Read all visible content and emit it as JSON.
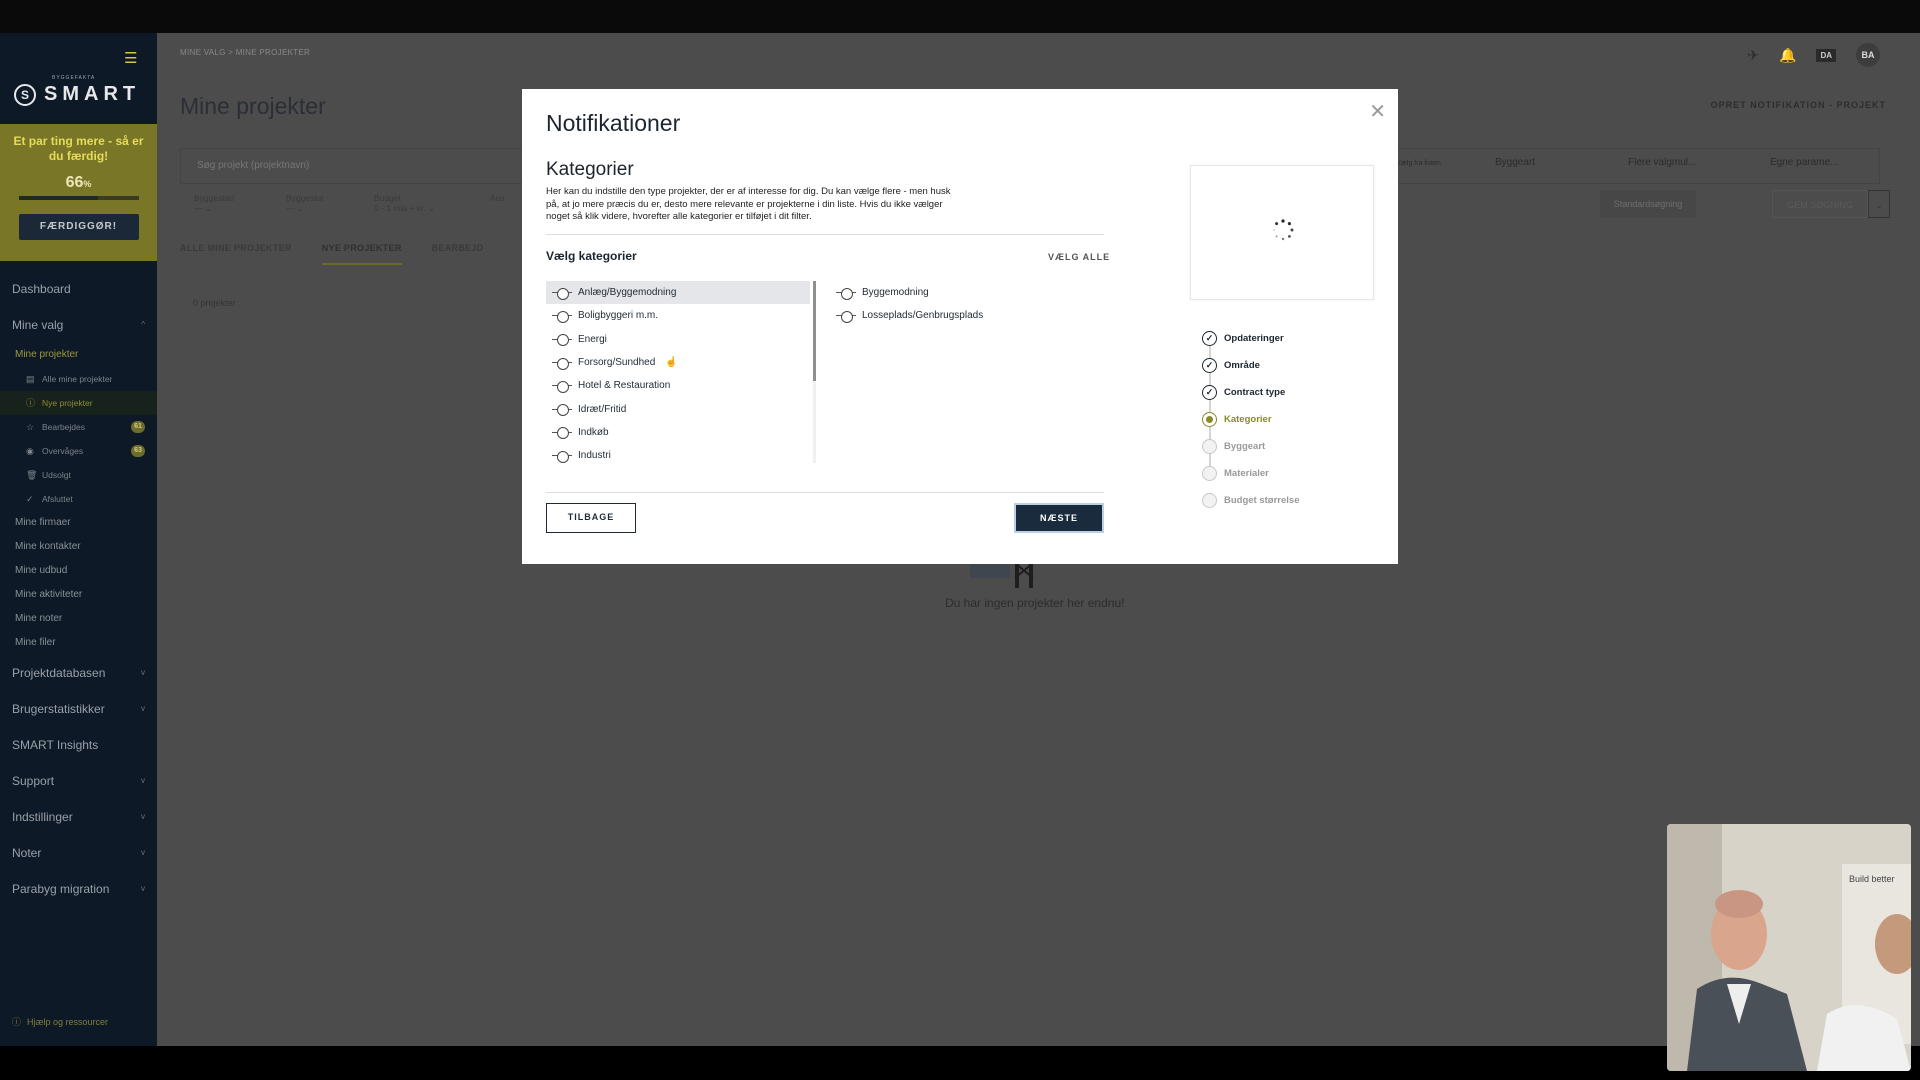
{
  "sidebar": {
    "logo_text": "SMART",
    "logo_sub": "BYGGEFAKTA",
    "promo": {
      "title": "Et par ting mere - så er du færdig!",
      "percent": "66",
      "percent_unit": "%",
      "progress": 0.66,
      "button": "FÆRDIGGØR!"
    },
    "nav": [
      "Dashboard",
      "Mine valg",
      "Projektdatabasen",
      "Brugerstatistikker",
      "SMART Insights",
      "Support",
      "Indstillinger",
      "Noter",
      "Parabyg migration"
    ],
    "mine_valg_sub": {
      "projects": "Mine projekter",
      "project_items": [
        {
          "label": "Alle mine projekter"
        },
        {
          "label": "Nye projekter"
        },
        {
          "label": "Bearbejdes",
          "badge": "61"
        },
        {
          "label": "Overvåges",
          "badge": "63"
        },
        {
          "label": "Udsolgt"
        },
        {
          "label": "Afsluttet"
        }
      ],
      "others": [
        "Mine firmaer",
        "Mine kontakter",
        "Mine udbud",
        "Mine aktiviteter",
        "Mine noter",
        "Mine filer"
      ]
    },
    "help": "Hjælp og ressourcer"
  },
  "header": {
    "breadcrumb": "MINE VALG  >  MINE PROJEKTER",
    "title": "Mine projekter",
    "lang": "DA",
    "avatar": "BA",
    "create_notification": "OPRET NOTIFIKATION - PROJEKT"
  },
  "filters": {
    "search_placeholder": "Søg projekt (projektnavn)",
    "groups": [
      {
        "label": "Byggestart",
        "value": "— ⌄"
      },
      {
        "label": "Byggeslut",
        "value": "— ⌄"
      },
      {
        "label": "Budget",
        "value": "0 - 1 mia + kr. ⌄"
      },
      {
        "label": "Ans",
        "value": ""
      }
    ],
    "chips": [
      "Vælg fra listen",
      "Byggeart",
      "Flere valgmul...",
      "Egne parame..."
    ],
    "standard_button": "Standardsøgning",
    "save_button": "GEM SØGNING"
  },
  "tabs": [
    "ALLE MINE PROJEKTER",
    "NYE PROJEKTER",
    "BEARBEJD"
  ],
  "project_count": "0 projekter",
  "empty_text": "Du har ingen projekter her endnu!",
  "modal": {
    "title": "Notifikationer",
    "section_title": "Kategorier",
    "description": "Her kan du indstille den type projekter, der er af interesse for dig. Du kan vælge flere - men husk på, at jo mere præcis du er, desto mere relevante er projekterne i din liste. Hvis du ikke vælger noget så klik videre, hvorefter alle kategorier er tilføjet i dit filter.",
    "pick_label": "Vælg kategorier",
    "select_all": "VÆLG ALLE",
    "left_categories": [
      "Anlæg/Byggemodning",
      "Boligbyggeri m.m.",
      "Energi",
      "Forsorg/Sundhed",
      "Hotel & Restauration",
      "Idræt/Fritid",
      "Indkøb",
      "Industri"
    ],
    "right_categories": [
      "Byggemodning",
      "Losseplads/Genbrugsplads"
    ],
    "back_button": "TILBAGE",
    "next_button": "NÆSTE",
    "steps": [
      {
        "label": "Opdateringer",
        "state": "done"
      },
      {
        "label": "Område",
        "state": "done"
      },
      {
        "label": "Contract type",
        "state": "done"
      },
      {
        "label": "Kategorier",
        "state": "current"
      },
      {
        "label": "Byggeart",
        "state": "todo"
      },
      {
        "label": "Materialer",
        "state": "todo"
      },
      {
        "label": "Budget størrelse",
        "state": "todo"
      }
    ]
  },
  "webcam": {
    "sign_text": "Build better"
  }
}
